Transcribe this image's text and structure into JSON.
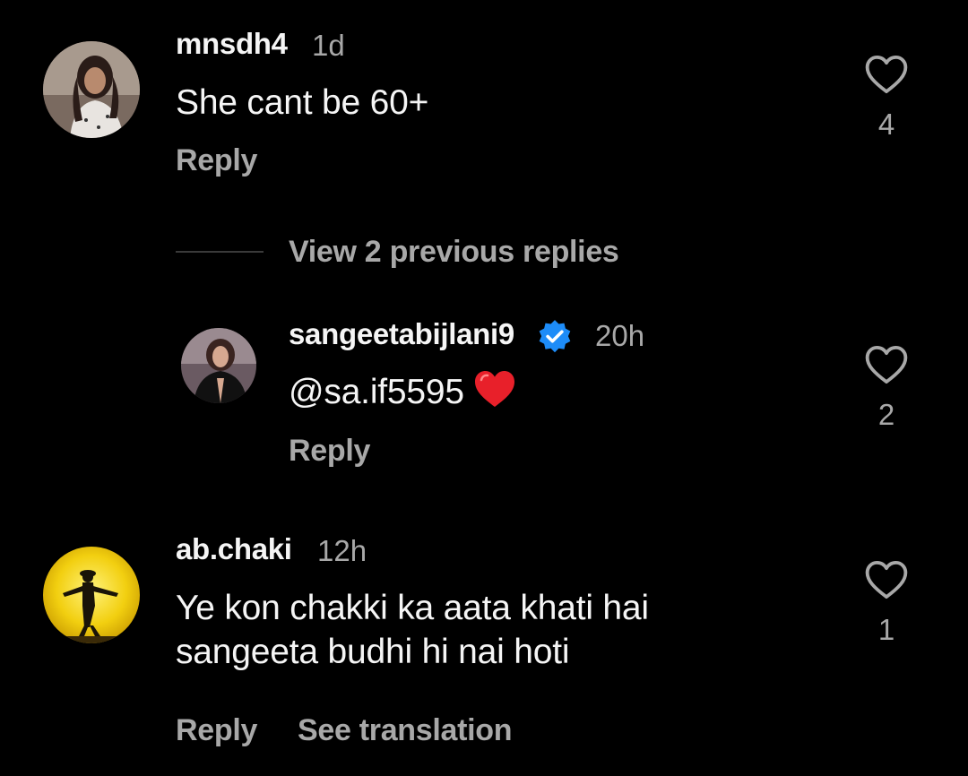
{
  "comments": [
    {
      "username": "mnsdh4",
      "time": "1d",
      "text": "She cant be 60+",
      "reply_label": "Reply",
      "likes": "4"
    },
    {
      "username": "sangeetabijlani9",
      "verified": true,
      "time": "20h",
      "text": "@sa.if5595",
      "emoji": "red-heart",
      "reply_label": "Reply",
      "likes": "2"
    },
    {
      "username": "ab.chaki",
      "time": "12h",
      "text_lines": [
        "Ye kon chakki ka aata khati hai",
        "sangeeta budhi hi nai hoti"
      ],
      "reply_label": "Reply",
      "see_translation_label": "See translation",
      "likes": "1"
    }
  ],
  "view_replies_label": "View 2 previous replies",
  "colors": {
    "background": "#000000",
    "primary_text": "#f5f5f5",
    "secondary_text": "#a8a8a8",
    "verified_badge": "#1d8cf8",
    "heart_emoji": "#e8202a"
  },
  "icons": [
    "heart-outline-icon",
    "verified-badge-icon",
    "red-heart-emoji"
  ]
}
